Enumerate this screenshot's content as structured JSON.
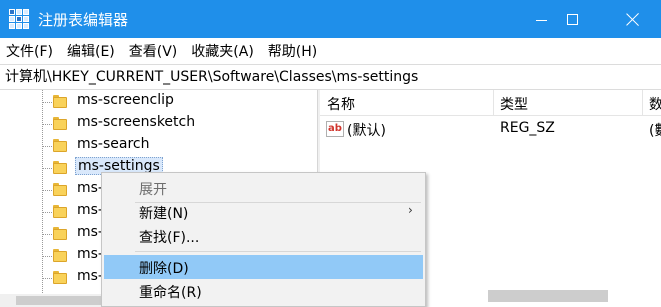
{
  "window": {
    "title": "注册表编辑器",
    "controls": {
      "minimize": "minimize",
      "maximize": "maximize",
      "close": "close"
    }
  },
  "menubar": {
    "items": [
      {
        "label": "文件(F)"
      },
      {
        "label": "编辑(E)"
      },
      {
        "label": "查看(V)"
      },
      {
        "label": "收藏夹(A)"
      },
      {
        "label": "帮助(H)"
      }
    ]
  },
  "address": {
    "path": "计算机\\HKEY_CURRENT_USER\\Software\\Classes\\ms-settings"
  },
  "tree": {
    "items": [
      {
        "label": "ms-screenclip",
        "selected": false
      },
      {
        "label": "ms-screensketch",
        "selected": false
      },
      {
        "label": "ms-search",
        "selected": false
      },
      {
        "label": "ms-settings",
        "selected": true
      },
      {
        "label": "ms-",
        "selected": false
      },
      {
        "label": "ms-",
        "selected": false
      },
      {
        "label": "ms-",
        "selected": false
      },
      {
        "label": "ms-",
        "selected": false
      },
      {
        "label": "ms-",
        "selected": false
      }
    ]
  },
  "list": {
    "columns": [
      {
        "label": "名称"
      },
      {
        "label": "类型"
      },
      {
        "label": "数"
      }
    ],
    "rows": [
      {
        "icon": "ab",
        "name": "(默认)",
        "type": "REG_SZ",
        "data": "(數"
      }
    ]
  },
  "context_menu": {
    "items": [
      {
        "label": "展开",
        "kind": "header"
      },
      {
        "label": "新建(N)",
        "kind": "submenu",
        "arrow": "›"
      },
      {
        "label": "查找(F)...",
        "kind": "item"
      },
      {
        "label": "删除(D)",
        "kind": "item",
        "hover": true
      },
      {
        "label": "重命名(R)",
        "kind": "item"
      }
    ]
  },
  "colors": {
    "titlebar": "#1f8fea",
    "menu_hover": "#91c9f7",
    "selected_node": "#d9e8fb"
  }
}
